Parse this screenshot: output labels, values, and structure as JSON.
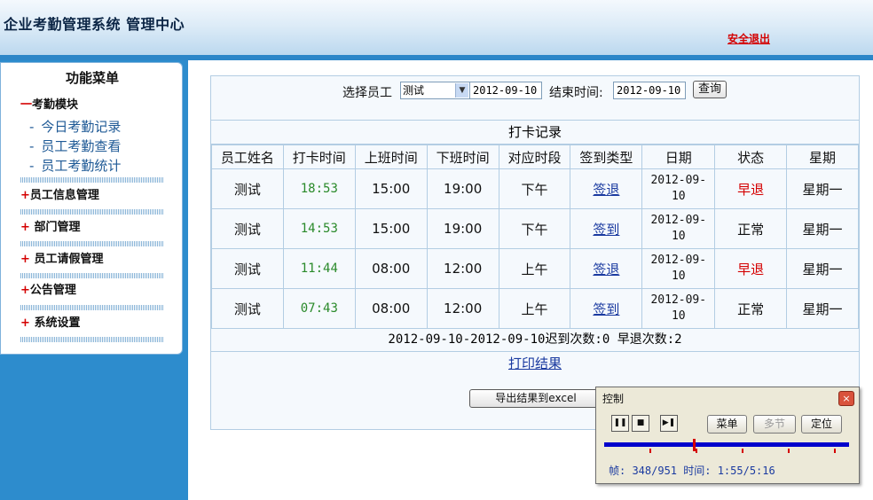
{
  "header": {
    "title": "企业考勤管理系统 管理中心",
    "logout_label": "安全退出"
  },
  "menu": {
    "title": "功能菜单",
    "attendance_module": {
      "mark": "一",
      "label": "考勤模块",
      "items": [
        {
          "dash": "-",
          "label": "今日考勤记录"
        },
        {
          "dash": "-",
          "label": "员工考勤查看"
        },
        {
          "dash": "-",
          "label": "员工考勤统计"
        }
      ]
    },
    "modules": [
      {
        "mark": "+",
        "label": "员工信息管理"
      },
      {
        "mark": "+",
        "label": "部门管理"
      },
      {
        "mark": "+",
        "label": "员工请假管理"
      },
      {
        "mark": "+",
        "label": "公告管理"
      },
      {
        "mark": "+",
        "label": "系统设置"
      }
    ]
  },
  "filter": {
    "employee_label": "选择员工",
    "employee_value": "测试",
    "start_date": "2012-09-10",
    "end_label": "结束时间:",
    "end_date": "2012-09-10",
    "query_label": "查询"
  },
  "records": {
    "title": "打卡记录",
    "columns": [
      "员工姓名",
      "打卡时间",
      "上班时间",
      "下班时间",
      "对应时段",
      "签到类型",
      "日期",
      "状态",
      "星期"
    ],
    "rows": [
      {
        "name": "测试",
        "punch": "18:53",
        "start": "15:00",
        "end": "19:00",
        "period": "下午",
        "type": "签退",
        "date_a": "2012-09-",
        "date_b": "10",
        "status": "早退",
        "weekday": "星期一"
      },
      {
        "name": "测试",
        "punch": "14:53",
        "start": "15:00",
        "end": "19:00",
        "period": "下午",
        "type": "签到",
        "date_a": "2012-09-",
        "date_b": "10",
        "status": "正常",
        "weekday": "星期一"
      },
      {
        "name": "测试",
        "punch": "11:44",
        "start": "08:00",
        "end": "12:00",
        "period": "上午",
        "type": "签退",
        "date_a": "2012-09-",
        "date_b": "10",
        "status": "早退",
        "weekday": "星期一"
      },
      {
        "name": "测试",
        "punch": "07:43",
        "start": "08:00",
        "end": "12:00",
        "period": "上午",
        "type": "签到",
        "date_a": "2012-09-",
        "date_b": "10",
        "status": "正常",
        "weekday": "星期一"
      }
    ],
    "summary": "2012-09-10-2012-09-10迟到次数:0 早退次数:2",
    "print_label": "打印结果",
    "export_label": "导出结果到excel"
  },
  "control": {
    "title": "控制",
    "close_icon": "×",
    "play_pause_icon": "pause-icon",
    "stop_icon": "stop-icon",
    "step_icon": "step-forward-icon",
    "menu_label": "菜单",
    "chapters_label": "多节",
    "locate_label": "定位",
    "progress": 0.366,
    "status": "帧: 348/951 时间: 1:55/5:16",
    "colors": {
      "track": "#0000cc",
      "thumb": "#d40000"
    }
  }
}
